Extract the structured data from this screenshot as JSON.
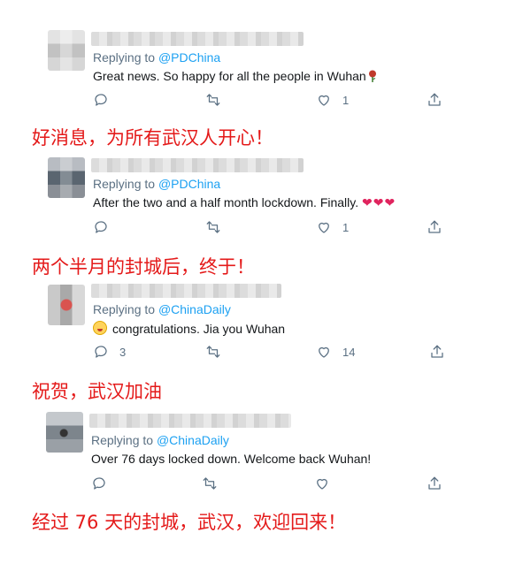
{
  "tweets": [
    {
      "replying_prefix": "Replying to",
      "handle": "@PDChina",
      "text": "Great news. So happy for all the people in Wuhan",
      "emoji": "rose-icon",
      "reply_count": "",
      "like_count": "1",
      "translation": "好消息，为所有武汉人开心！"
    },
    {
      "replying_prefix": "Replying to",
      "handle": "@PDChina",
      "text": "After the two and a half month lockdown. Finally. ",
      "hearts": "❤❤❤",
      "reply_count": "",
      "like_count": "1",
      "translation": "两个半月的封城后，终于！"
    },
    {
      "replying_prefix": "Replying to",
      "handle": "@ChinaDaily",
      "emoji": "flushed-face-icon",
      "text": "congratulations. Jia you Wuhan",
      "reply_count": "3",
      "like_count": "14",
      "translation": "祝贺，武汉加油"
    },
    {
      "replying_prefix": "Replying to",
      "handle": "@ChinaDaily",
      "text": "Over 76 days locked down. Welcome back Wuhan!",
      "reply_count": "",
      "like_count": "",
      "translation": "经过 76 天的封城，武汉，欢迎回来！"
    }
  ],
  "colors": {
    "handle": "#1da1f2",
    "muted": "#5b7083",
    "annotation": "#e41a1a",
    "heart": "#e0245e"
  }
}
